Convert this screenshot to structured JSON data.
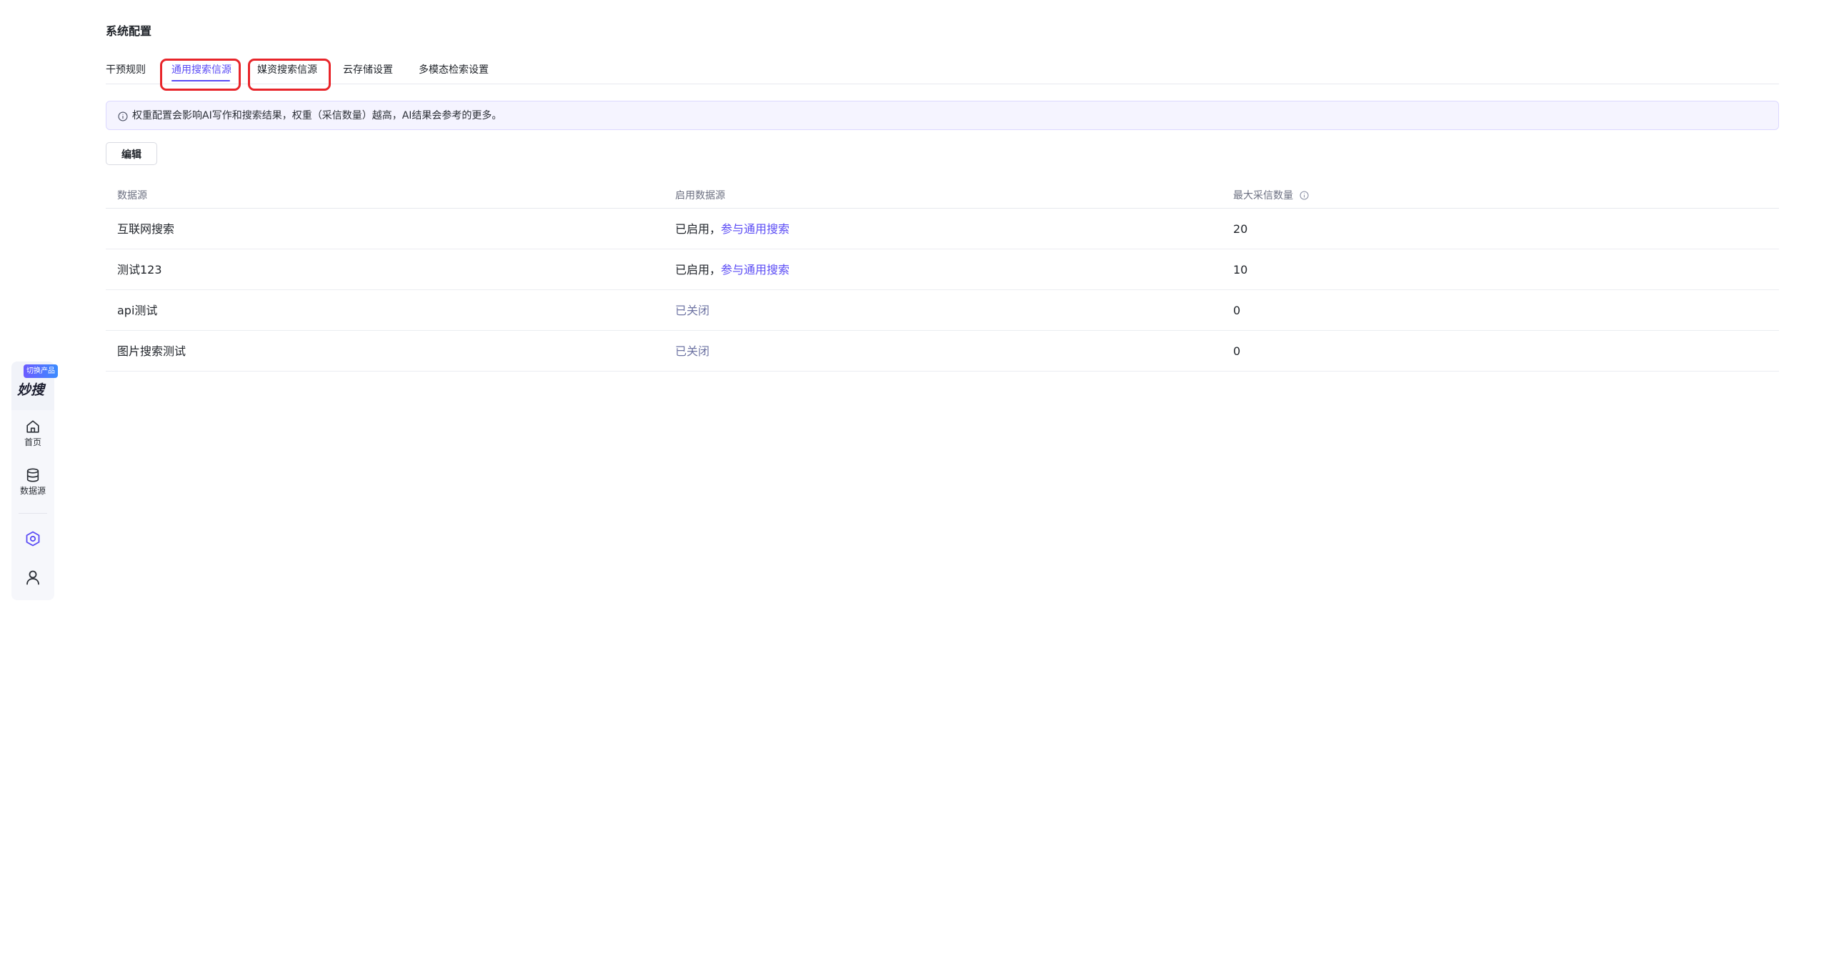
{
  "sidebar": {
    "brand_badge": "切换产品",
    "brand_logo": "妙搜",
    "items": [
      {
        "label": "首页",
        "icon": "home-icon"
      },
      {
        "label": "数据源",
        "icon": "database-icon"
      }
    ],
    "settings_icon": "settings-hexagon-icon",
    "user_icon": "user-icon",
    "accent_color": "#5a4bf5"
  },
  "page": {
    "title": "系统配置"
  },
  "tabs": [
    {
      "label": "干预规则",
      "active": false
    },
    {
      "label": "通用搜索信源",
      "active": true
    },
    {
      "label": "媒资搜索信源",
      "active": false
    },
    {
      "label": "云存储设置",
      "active": false
    },
    {
      "label": "多模态检索设置",
      "active": false
    }
  ],
  "alert": {
    "icon": "info-circle-icon",
    "text": "权重配置会影响AI写作和搜索结果，权重（采信数量）越高，AI结果会参考的更多。"
  },
  "toolbar": {
    "edit_label": "编辑"
  },
  "table": {
    "headers": {
      "source": "数据源",
      "enabled": "启用数据源",
      "max_count": "最大采信数量",
      "max_count_icon": "info-circle-icon"
    },
    "rows": [
      {
        "source": "互联网搜索",
        "status": "已启用，",
        "status_link": "参与通用搜索",
        "max_count": "20"
      },
      {
        "source": "测试123",
        "status": "已启用，",
        "status_link": "参与通用搜索",
        "max_count": "10"
      },
      {
        "source": "api测试",
        "status": "已关闭",
        "status_link": "",
        "max_count": "0"
      },
      {
        "source": "图片搜索测试",
        "status": "已关闭",
        "status_link": "",
        "max_count": "0"
      }
    ]
  },
  "colors": {
    "accent": "#5a4bf5",
    "highlight_box": "#e8252a",
    "alert_bg": "#f5f4ff"
  }
}
